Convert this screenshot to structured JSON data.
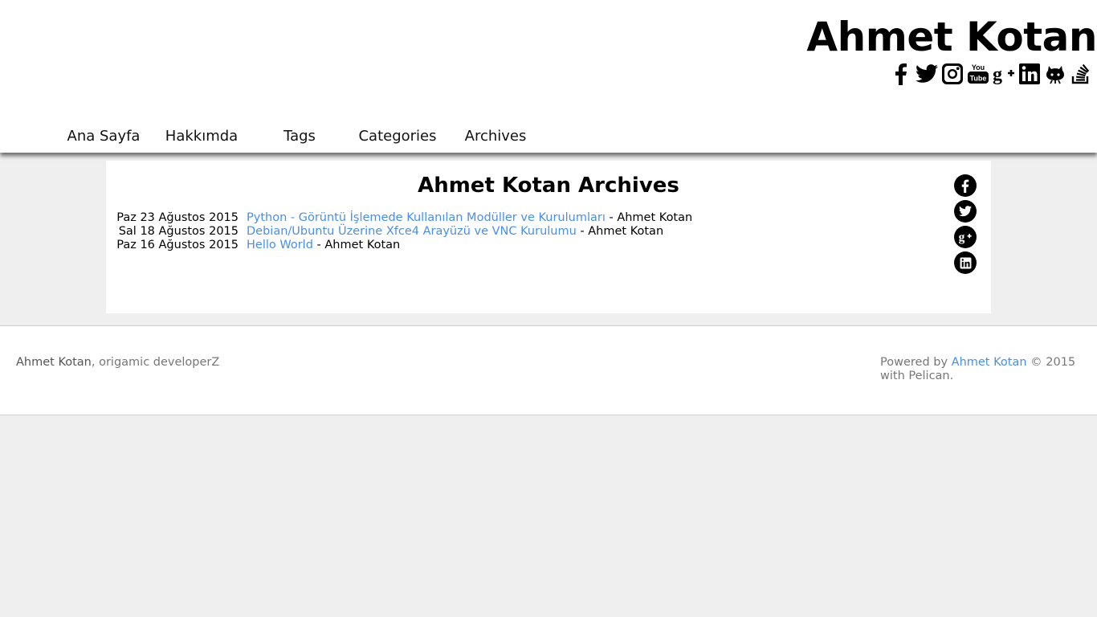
{
  "header": {
    "site_title": "Ahmet Kotan",
    "social_icons": [
      "facebook-icon",
      "twitter-icon",
      "instagram-icon",
      "youtube-icon",
      "google-plus-icon",
      "linkedin-icon",
      "github-icon",
      "stackoverflow-icon"
    ]
  },
  "nav": {
    "items": [
      {
        "label": "Ana Sayfa"
      },
      {
        "label": "Hakkımda"
      },
      {
        "label": "Tags"
      },
      {
        "label": "Categories"
      },
      {
        "label": "Archives"
      }
    ]
  },
  "main": {
    "heading": "Ahmet Kotan Archives",
    "archives": [
      {
        "date": "Paz 23 Ağustos 2015",
        "title": "Python - Görüntü İşlemede Kullanılan Modüller ve Kurulumları",
        "separator": " - ",
        "author": "Ahmet Kotan"
      },
      {
        "date": "Sal 18 Ağustos 2015",
        "title": "Debian/Ubuntu Üzerine Xfce4 Arayüzü ve VNC Kurulumu",
        "separator": " - ",
        "author": "Ahmet Kotan"
      },
      {
        "date": "Paz 16 Ağustos 2015",
        "title": "Hello World",
        "separator": " - ",
        "author": "Ahmet Kotan"
      }
    ],
    "share_icons": [
      "facebook-icon",
      "twitter-icon",
      "google-plus-icon",
      "linkedin-icon"
    ]
  },
  "footer": {
    "left_name": "Ahmet Kotan",
    "left_tagline": ", origamic developerZ",
    "powered_prefix": "Powered by ",
    "powered_link": "Ahmet Kotan",
    "powered_suffix": " © 2015 with Pelican."
  },
  "colors": {
    "link": "#4a90e2",
    "page_background": "#efefef",
    "card_background": "#ffffff"
  }
}
